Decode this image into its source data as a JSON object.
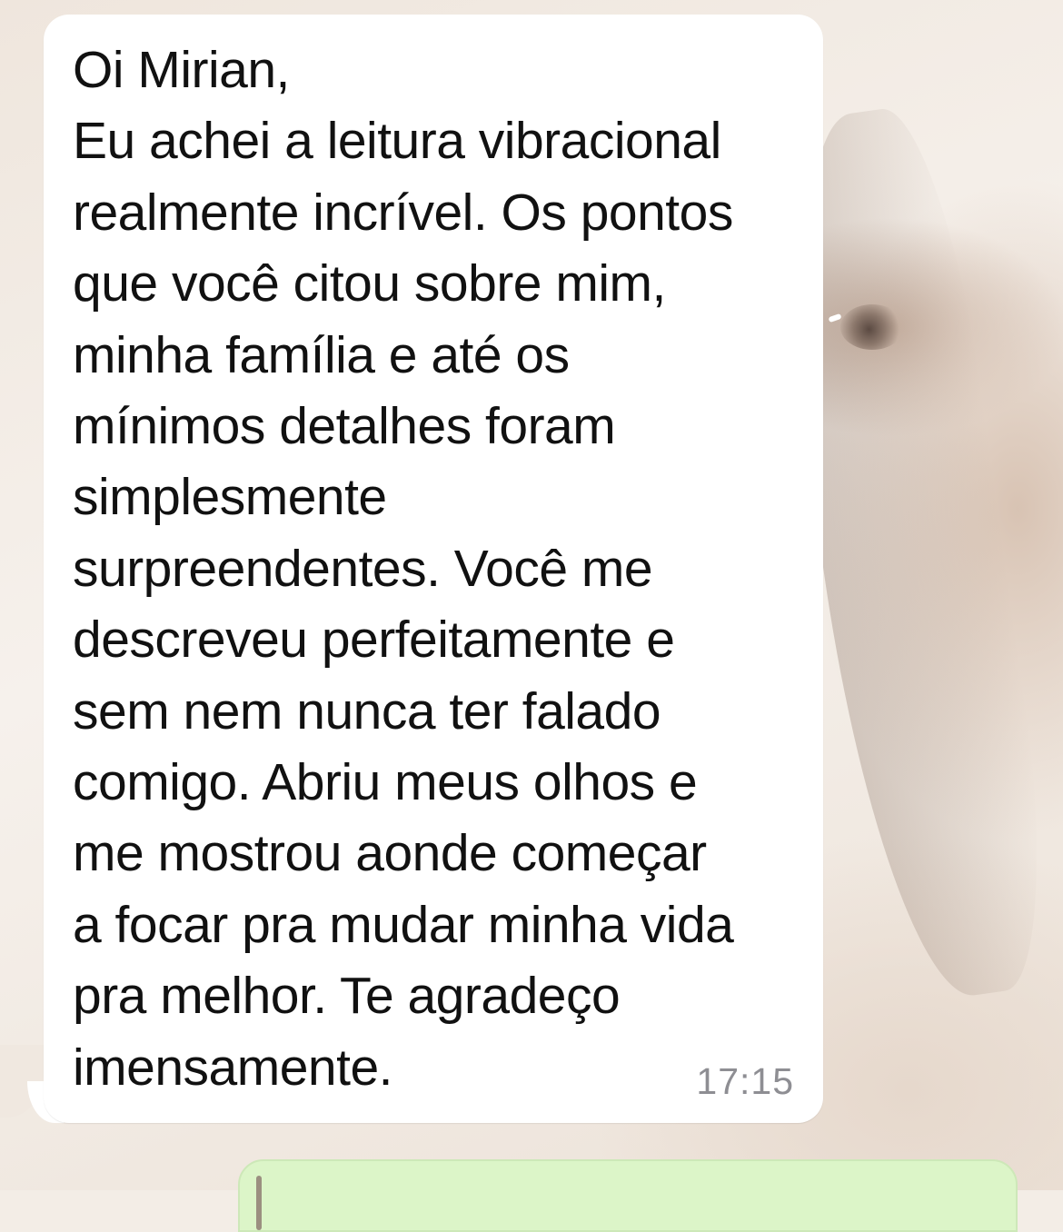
{
  "chat": {
    "incoming_message": {
      "lines": [
        "Oi Mirian,",
        "Eu achei a leitura vibracional",
        "realmente incrível. Os pontos",
        "que você citou sobre mim,",
        "minha família e até os",
        "mínimos detalhes foram",
        "simplesmente",
        "surpreendentes. Você me",
        "descreveu perfeitamente e",
        "sem nem nunca ter falado",
        "comigo. Abriu meus olhos e",
        "me mostrou aonde começar",
        "a focar pra mudar minha vida",
        "pra melhor. Te agradeço",
        "imensamente."
      ],
      "time": "17:15"
    }
  },
  "colors": {
    "incoming_bubble": "#ffffff",
    "outgoing_bubble": "#dcf5c8",
    "message_text": "#111111",
    "timestamp": "#8e8e93"
  }
}
